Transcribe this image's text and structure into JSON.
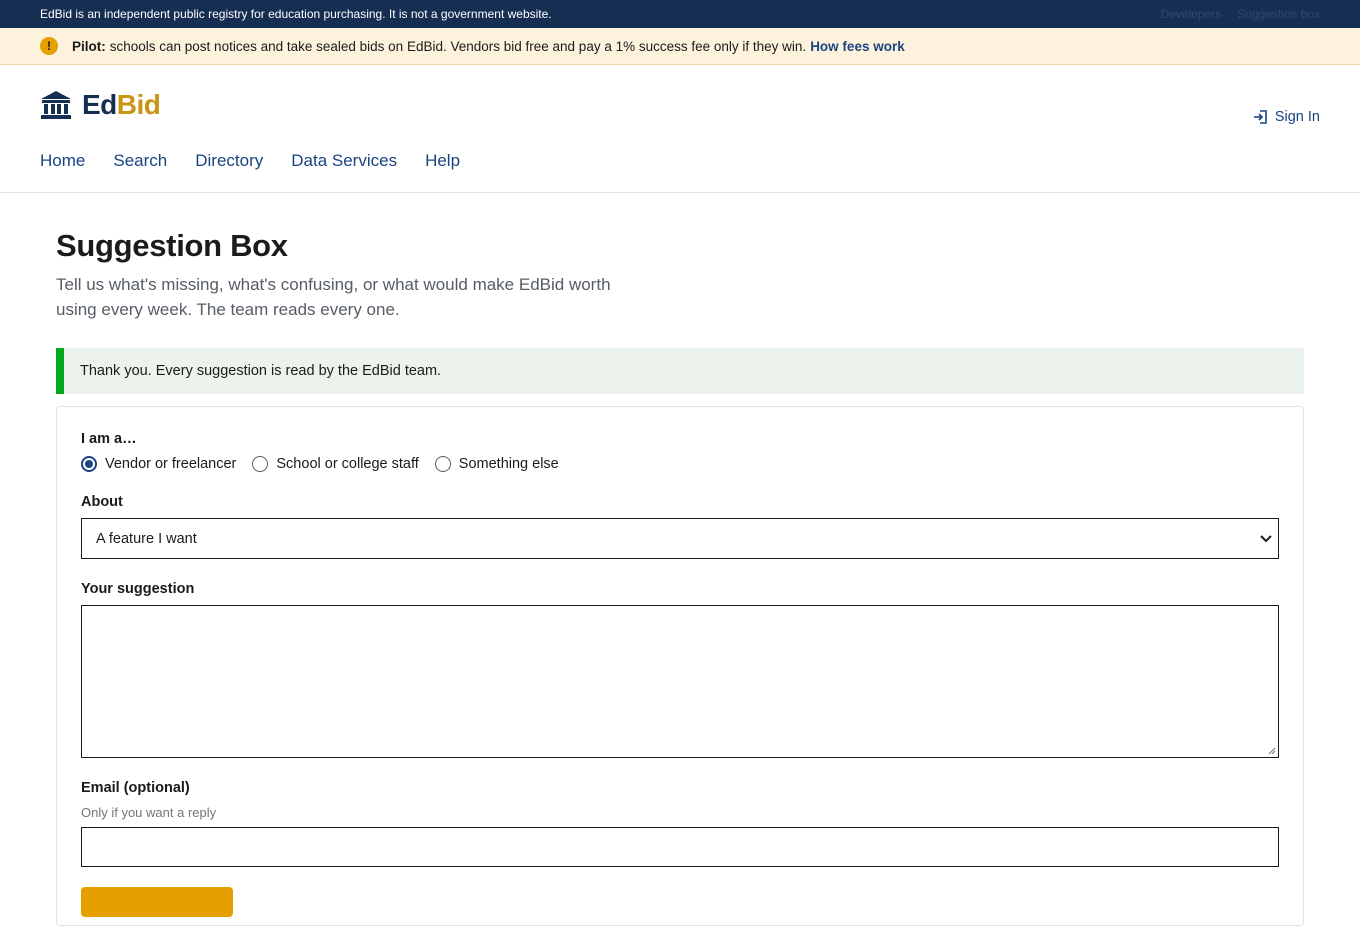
{
  "topbar": {
    "notice": "EdBid is an independent public registry for education purchasing. It is not a government website.",
    "links": [
      "Developers",
      "Suggestion box"
    ]
  },
  "pilot": {
    "strong": "Pilot:",
    "text": "schools can post notices and take sealed bids on EdBid. Vendors bid free and pay a 1% success fee only if they win.",
    "link": "How fees work",
    "icon": "warning-icon"
  },
  "brand": {
    "part1": "Ed",
    "part2": "Bid",
    "icon": "bank-icon",
    "colors": {
      "primary": "#162e51",
      "accent": "#c99512"
    }
  },
  "header": {
    "signin": "Sign In",
    "nav": [
      "Home",
      "Search",
      "Directory",
      "Data Services",
      "Help"
    ]
  },
  "page": {
    "title": "Suggestion Box",
    "subtitle": "Tell us what's missing, what's confusing, or what would make EdBid worth using every week. The team reads every one."
  },
  "alert": {
    "text": "Thank you. Every suggestion is read by the EdBid team.",
    "color": "#00a91c"
  },
  "form": {
    "role_label": "I am a…",
    "roles": [
      {
        "label": "Vendor or freelancer",
        "checked": true
      },
      {
        "label": "School or college staff",
        "checked": false
      },
      {
        "label": "Something else",
        "checked": false
      }
    ],
    "about_label": "About",
    "about_value": "A feature I want",
    "suggestion_label": "Your suggestion",
    "suggestion_value": "",
    "email_label": "Email (optional)",
    "email_hint": "Only if you want a reply",
    "email_value": "",
    "submit_color": "#e5a000"
  }
}
